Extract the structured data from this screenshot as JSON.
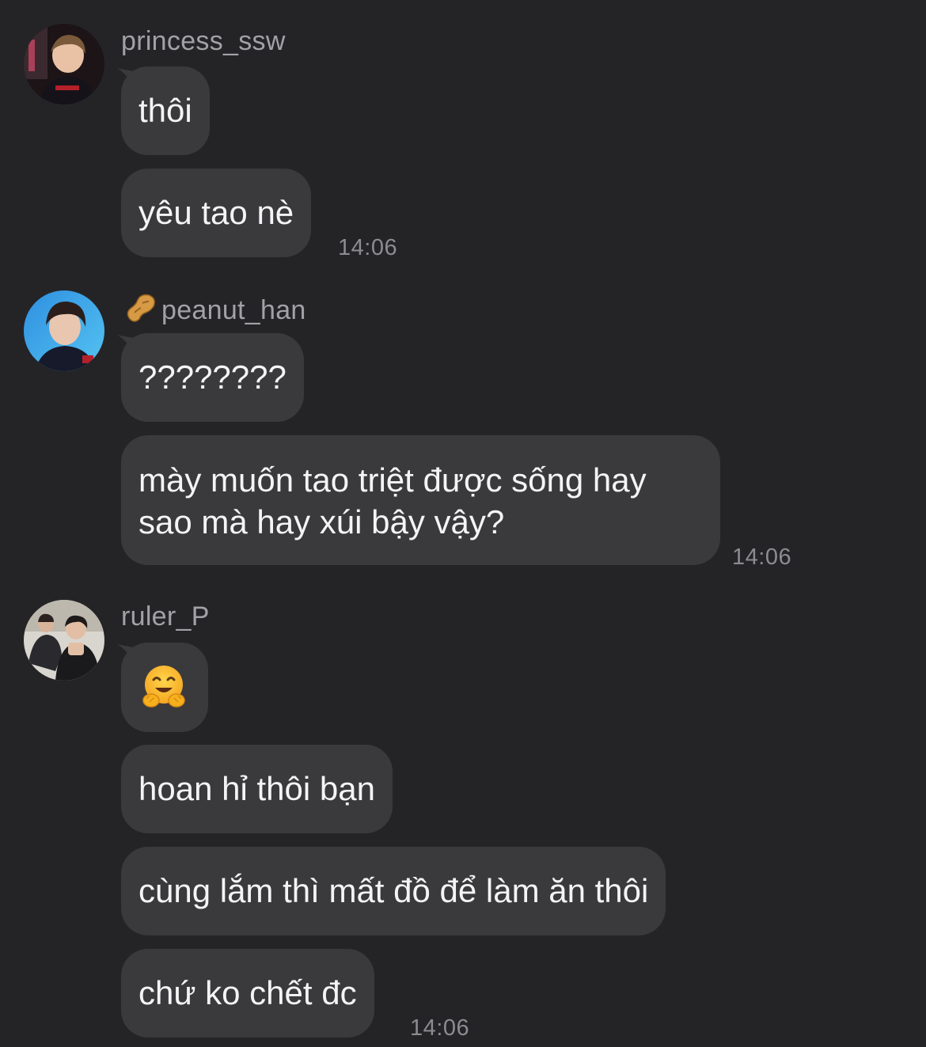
{
  "groups": [
    {
      "sender": "princess_ssw",
      "avatar": "avatar-princess-ssw",
      "messages": [
        "thôi",
        "yêu tao nè"
      ],
      "time": "14:06"
    },
    {
      "sender": "peanut_han",
      "sender_prefix_icon": "peanut-icon",
      "avatar": "avatar-peanut-han",
      "messages": [
        "????????",
        "mày muốn tao triệt được sống hay sao mà hay xúi bậy vậy?"
      ],
      "time": "14:06"
    },
    {
      "sender": "ruler_P",
      "avatar": "avatar-ruler-p",
      "messages": [
        "hugging-face-emoji",
        "hoan hỉ thôi bạn",
        "cùng lắm thì mất đồ để làm ăn thôi",
        "chứ ko chết đc"
      ],
      "time": "14:06"
    }
  ],
  "colors": {
    "background": "#242427",
    "bubble": "#3a3a3d",
    "sender_name": "#a2a2a6",
    "timestamp": "#8c8c90",
    "text": "#f4f4f6"
  }
}
